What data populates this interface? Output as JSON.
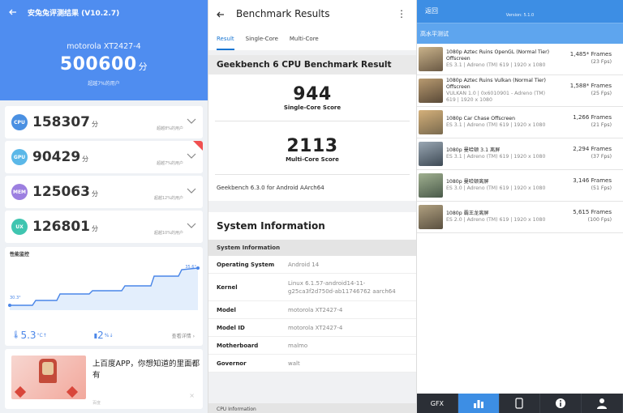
{
  "antutu": {
    "title": "安兔兔评测结果 (V10.2.7)",
    "model": "motorola XT2427-4",
    "total": "500600",
    "unit": "分",
    "beat": "超越7%的用户",
    "rows": [
      {
        "badge": "CPU",
        "score": "158307",
        "pct": "超越8%的用户",
        "color": "#4a90e2"
      },
      {
        "badge": "GPU",
        "score": "90429",
        "pct": "超越7%的用户",
        "color": "#5bb8e8"
      },
      {
        "badge": "MEM",
        "score": "125063",
        "pct": "超越12%的用户",
        "color": "#9c7fe0"
      },
      {
        "badge": "UX",
        "score": "126801",
        "pct": "超越10%的用户",
        "color": "#3fc5b0"
      }
    ],
    "monitor_title": "性能监控",
    "temp_start": "30.3°",
    "temp_end": "35.6°",
    "temp_rise": "5.3",
    "temp_rise_unit": "°C↑",
    "battery_drop": "2",
    "battery_drop_unit": "%↓",
    "details": "查看详情",
    "ad_text": "上百度APP，你想知道的里面都有",
    "ad_src": "百度",
    "ad_close": "×"
  },
  "geekbench": {
    "header": "Benchmark Results",
    "more_icon": "⋮",
    "tabs": [
      "Result",
      "Single-Core",
      "Multi-Core"
    ],
    "card_title": "Geekbench 6 CPU Benchmark Result",
    "single_score": "944",
    "single_label": "Single-Core Score",
    "multi_score": "2113",
    "multi_label": "Multi-Core Score",
    "version": "Geekbench 6.3.0 for Android AArch64",
    "sys_title": "System Information",
    "sys_sub": "System Information",
    "rows": [
      {
        "k": "Operating System",
        "v": "Android 14"
      },
      {
        "k": "Kernel",
        "v": "Linux 6.1.57-android14-11-g25ca3f2d750d-ab11746762 aarch64"
      },
      {
        "k": "Model",
        "v": "motorola XT2427-4"
      },
      {
        "k": "Model ID",
        "v": "motorola XT2427-4"
      },
      {
        "k": "Motherboard",
        "v": "malmo"
      },
      {
        "k": "Governor",
        "v": "walt"
      }
    ],
    "bottom": "CPU Information"
  },
  "gfx": {
    "back": "返回",
    "version": "Version: 5.1.0",
    "section": "高水平测试",
    "rows": [
      {
        "name": "1080p Aztec Ruins OpenGL (Normal Tier) Offscreen",
        "sub": "ES 3.1 | Adreno (TM) 619 | 1920 x 1080",
        "frames": "1,485* Frames",
        "fps": "(23 Fps)",
        "c1": "#6b5a45",
        "c2": "#c9b28a"
      },
      {
        "name": "1080p Aztec Ruins Vulkan (Normal Tier) Offscreen",
        "sub": "VULKAN 1.0 | 0x6010901 - Adreno (TM) 619 | 1920 x 1080",
        "frames": "1,588* Frames",
        "fps": "(25 Fps)",
        "c1": "#5a4a38",
        "c2": "#b89a70"
      },
      {
        "name": "1080p Car Chase Offscreen",
        "sub": "ES 3.1 | Adreno (TM) 619 | 1920 x 1080",
        "frames": "1,266 Frames",
        "fps": "(21 Fps)",
        "c1": "#7a6a4e",
        "c2": "#d4b07a"
      },
      {
        "name": "1080p 曼哈顿 3.1 离屏",
        "sub": "ES 3.1 | Adreno (TM) 619 | 1920 x 1080",
        "frames": "2,294 Frames",
        "fps": "(37 Fps)",
        "c1": "#3e4a55",
        "c2": "#9aa7b3"
      },
      {
        "name": "1080p 曼哈顿离屏",
        "sub": "ES 3.0 | Adreno (TM) 619 | 1920 x 1080",
        "frames": "3,146 Frames",
        "fps": "(51 Fps)",
        "c1": "#4a5a4a",
        "c2": "#a0b090"
      },
      {
        "name": "1080p 霸王龙离屏",
        "sub": "ES 2.0 | Adreno (TM) 619 | 1920 x 1080",
        "frames": "5,615 Frames",
        "fps": "(100 Fps)",
        "c1": "#5a5040",
        "c2": "#b0a080"
      }
    ],
    "nav": [
      "GFX",
      "chart-icon",
      "phone-icon",
      "info-icon",
      "person-icon"
    ]
  }
}
